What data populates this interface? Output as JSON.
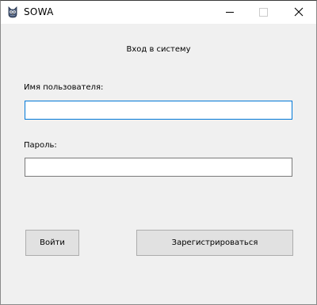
{
  "window": {
    "title": "SOWA",
    "icon": "owl-app-icon"
  },
  "form": {
    "heading": "Вход в систему",
    "username": {
      "label": "Имя пользователя:",
      "value": "",
      "placeholder": ""
    },
    "password": {
      "label": "Пароль:",
      "value": "",
      "placeholder": ""
    },
    "login_label": "Войти",
    "register_label": "Зарегистрироваться"
  },
  "colors": {
    "focus_border": "#0078d7",
    "client_background": "#f0f0f0",
    "button_face": "#e1e1e1"
  }
}
